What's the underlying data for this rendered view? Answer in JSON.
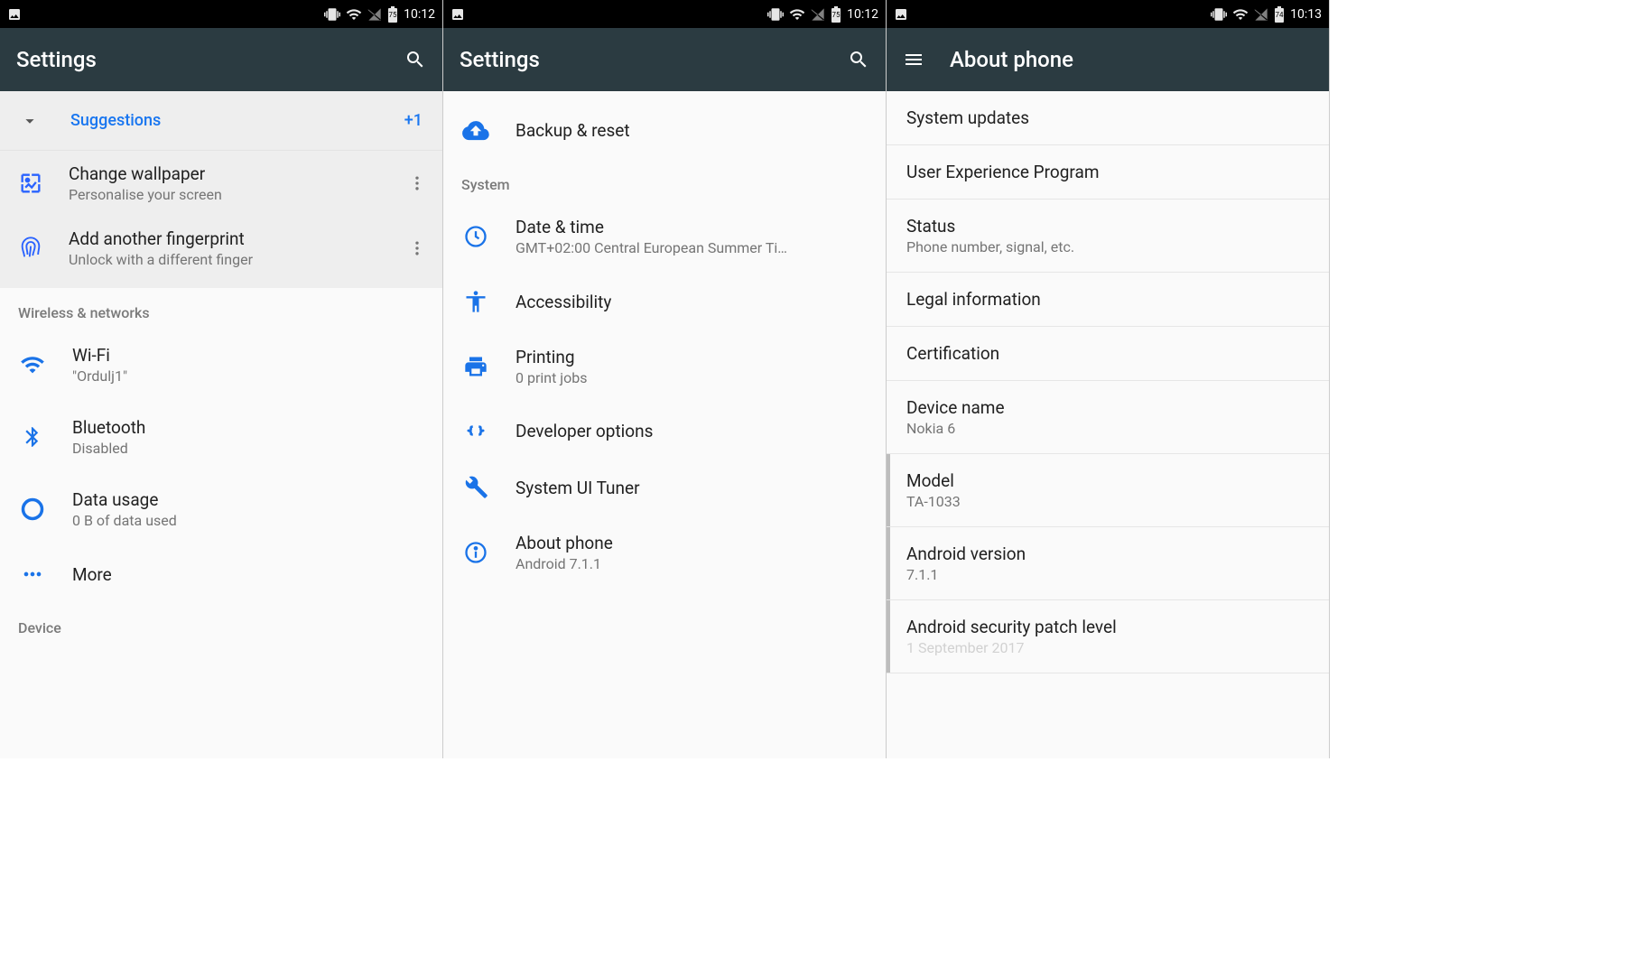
{
  "screens": {
    "left": {
      "status": {
        "time": "10:12",
        "battery": "75"
      },
      "appbar": {
        "title": "Settings"
      },
      "suggestions": {
        "label": "Suggestions",
        "badge": "+1",
        "items": [
          {
            "title": "Change wallpaper",
            "subtitle": "Personalise your screen"
          },
          {
            "title": "Add another fingerprint",
            "subtitle": "Unlock with a different finger"
          }
        ]
      },
      "wireless_header": "Wireless & networks",
      "wifi": {
        "title": "Wi-Fi",
        "subtitle": "\"Ordulj1\""
      },
      "bluetooth": {
        "title": "Bluetooth",
        "subtitle": "Disabled"
      },
      "datausage": {
        "title": "Data usage",
        "subtitle": "0 B of data used"
      },
      "more": {
        "title": "More"
      },
      "device_header": "Device"
    },
    "center": {
      "status": {
        "time": "10:12",
        "battery": "75"
      },
      "appbar": {
        "title": "Settings"
      },
      "backup": {
        "title": "Backup & reset"
      },
      "system_header": "System",
      "datetime": {
        "title": "Date & time",
        "subtitle": "GMT+02:00 Central European Summer Ti…"
      },
      "accessibility": {
        "title": "Accessibility"
      },
      "printing": {
        "title": "Printing",
        "subtitle": "0 print jobs"
      },
      "devopts": {
        "title": "Developer options"
      },
      "tuner": {
        "title": "System UI Tuner"
      },
      "about": {
        "title": "About phone",
        "subtitle": "Android 7.1.1"
      }
    },
    "right": {
      "status": {
        "time": "10:13",
        "battery": "74"
      },
      "appbar": {
        "title": "About phone"
      },
      "items": {
        "updates": "System updates",
        "uep": "User Experience Program",
        "status_t": "Status",
        "status_s": "Phone number, signal, etc.",
        "legal": "Legal information",
        "cert": "Certification",
        "devname_t": "Device name",
        "devname_s": "Nokia 6",
        "model_t": "Model",
        "model_s": "TA-1033",
        "aver_t": "Android version",
        "aver_s": "7.1.1",
        "patch_t": "Android security patch level",
        "patch_s": "1 September 2017"
      }
    }
  }
}
